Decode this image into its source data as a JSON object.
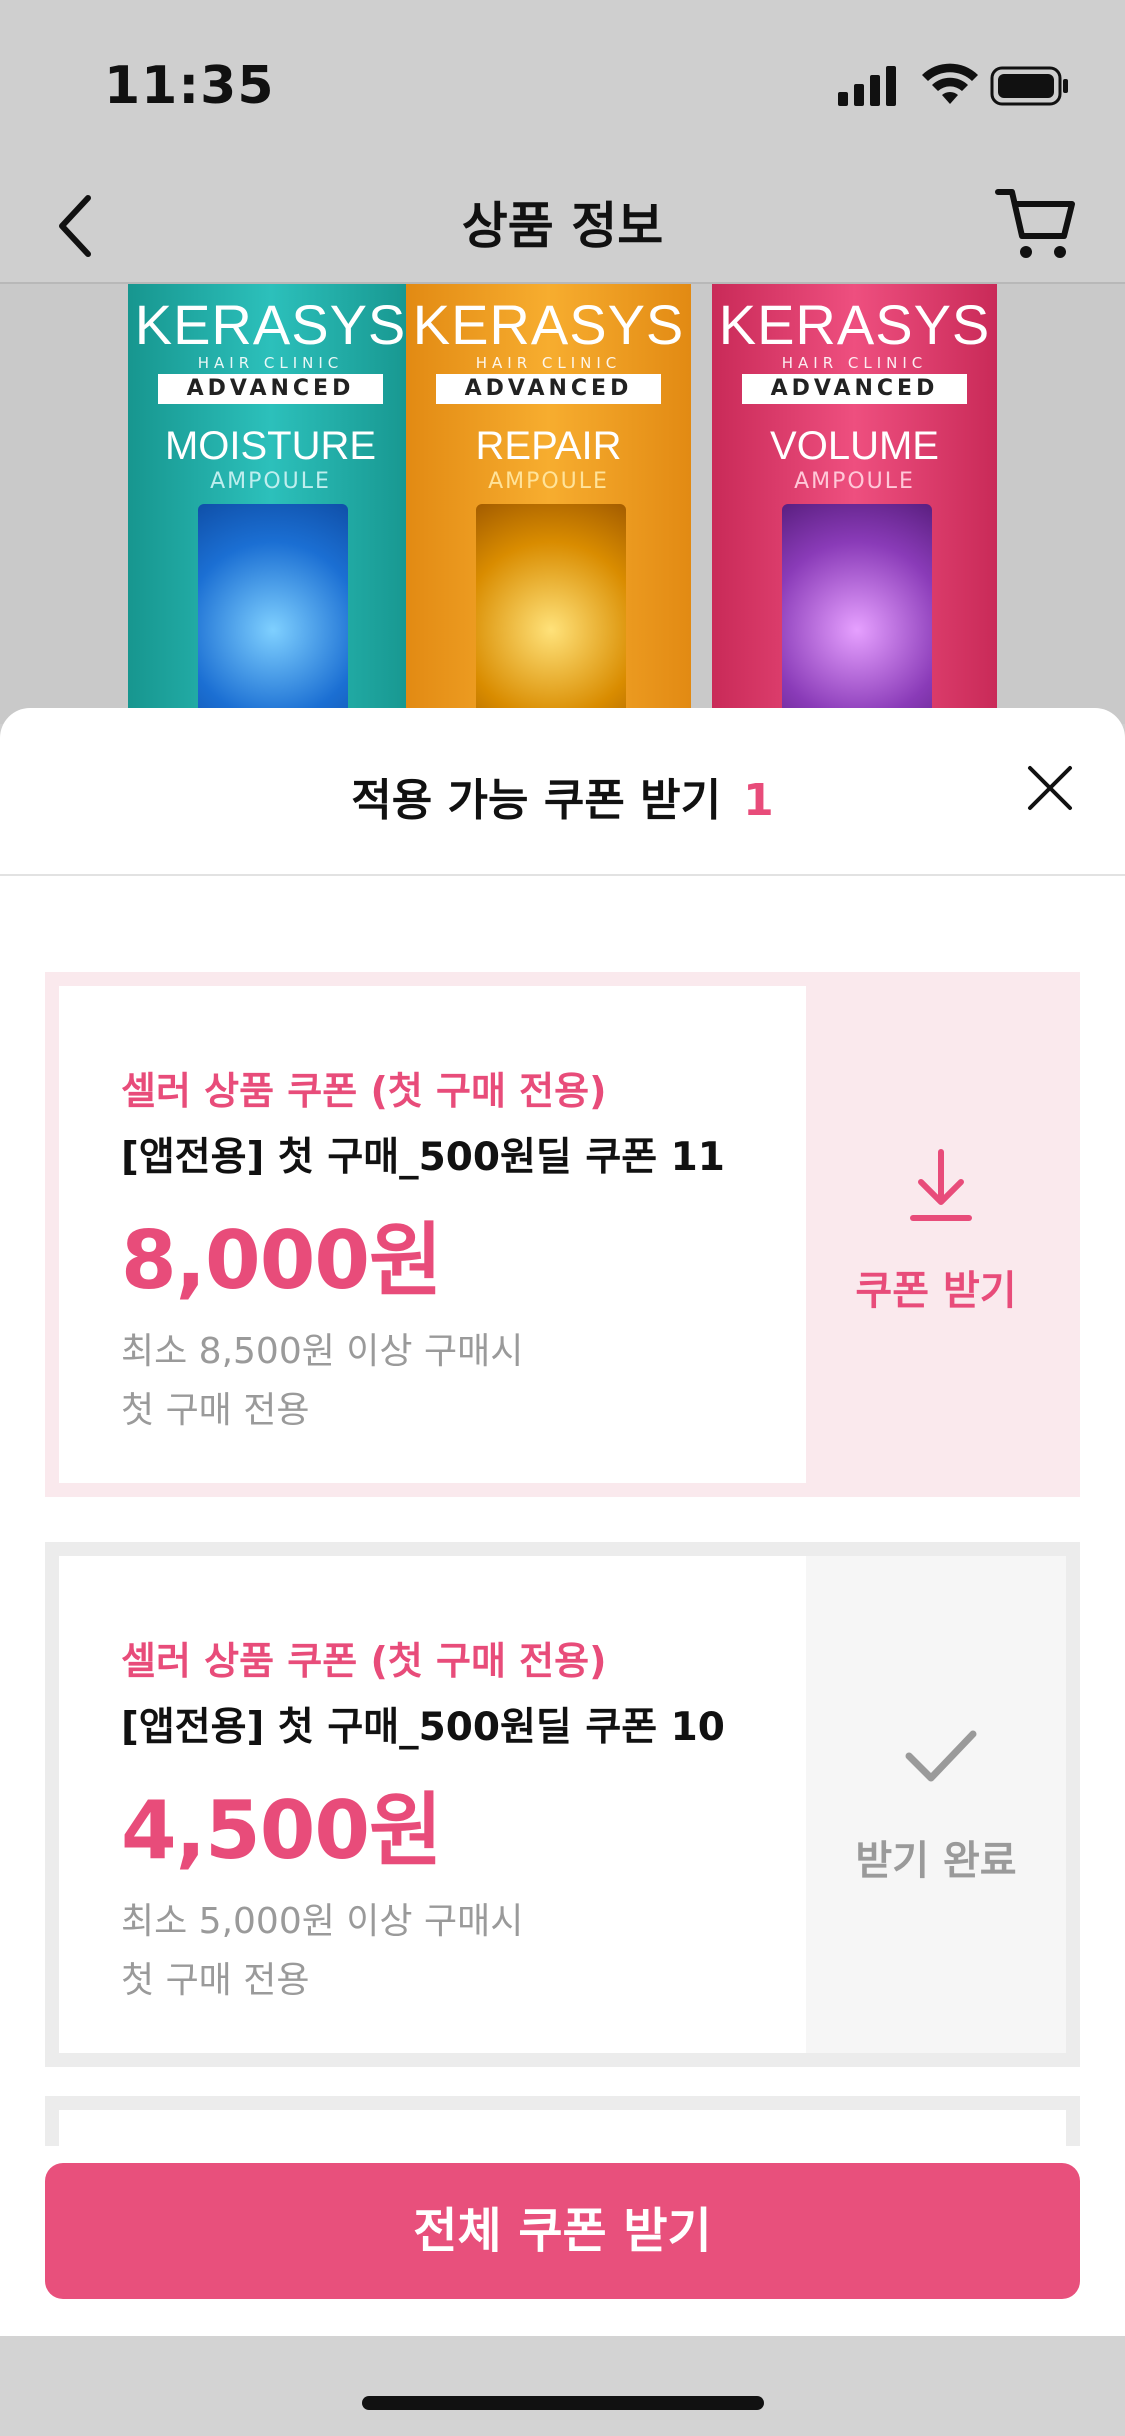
{
  "status_bar": {
    "time": "11:35"
  },
  "nav": {
    "title": "상품 정보"
  },
  "product": {
    "bottles": [
      {
        "brand": "KERASYS",
        "sub": "HAIR CLINIC",
        "line": "ADVANCED",
        "variant": "MOISTURE",
        "type": "AMPOULE",
        "color": "#1fa9a6"
      },
      {
        "brand": "KERASYS",
        "sub": "HAIR CLINIC",
        "line": "ADVANCED",
        "variant": "REPAIR",
        "type": "AMPOULE",
        "color": "#f19a1c"
      },
      {
        "brand": "KERASYS",
        "sub": "HAIR CLINIC",
        "line": "ADVANCED",
        "variant": "VOLUME",
        "type": "AMPOULE",
        "color": "#e03b6a"
      }
    ]
  },
  "sheet": {
    "title": "적용 가능 쿠폰 받기",
    "count": "1"
  },
  "coupons": [
    {
      "type": "셀러 상품 쿠폰 (첫 구매 전용)",
      "name": "[앱전용] 첫 구매_500원딜 쿠폰 11",
      "amount": "8,000원",
      "condition_min": "최소 8,500원 이상 구매시",
      "condition_first": "첫 구매 전용",
      "action_label": "쿠폰 받기",
      "action_icon": "download-icon"
    },
    {
      "type": "셀러 상품 쿠폰 (첫 구매 전용)",
      "name": "[앱전용] 첫 구매_500원딜 쿠폰 10",
      "amount": "4,500원",
      "condition_min": "최소 5,000원 이상 구매시",
      "condition_first": "첫 구매 전용",
      "action_label": "받기 완료",
      "action_icon": "check-icon"
    }
  ],
  "footer": {
    "button_label": "전체 쿠폰 받기"
  },
  "colors": {
    "accent": "#e84c7a",
    "active_bg": "#fae9ed",
    "done_bg": "#f6f6f6"
  }
}
